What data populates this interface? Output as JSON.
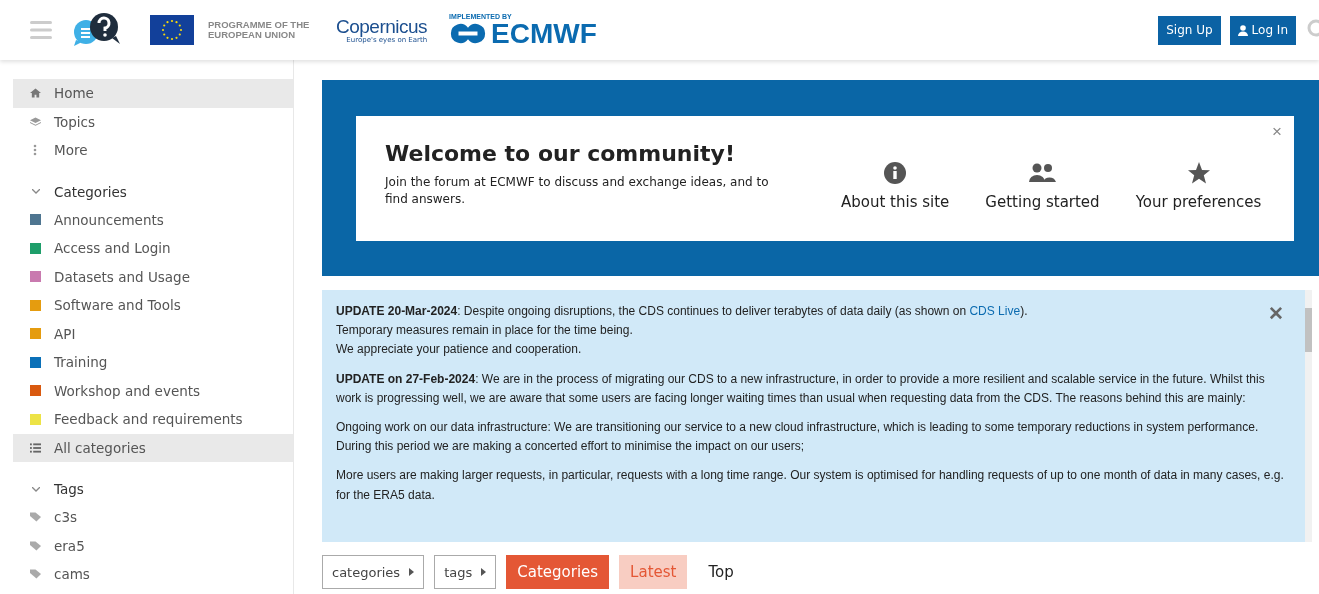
{
  "header": {
    "eu_label": "PROGRAMME OF THE EUROPEAN UNION",
    "copernicus": {
      "name": "Copernicus",
      "tagline": "Europe's eyes on Earth"
    },
    "ecmwf": {
      "caption": "IMPLEMENTED BY",
      "name": "ECMWF"
    },
    "buttons": [
      {
        "label": "Sign Up",
        "kind": "signup"
      },
      {
        "label": "Log In",
        "kind": "login"
      }
    ]
  },
  "sidebar": {
    "nav": [
      {
        "label": "Home",
        "kind": "home",
        "selected": true
      },
      {
        "label": "Topics",
        "kind": "topics",
        "selected": false
      },
      {
        "label": "More",
        "kind": "more",
        "selected": false
      }
    ],
    "categories_heading": "Categories",
    "categories_expanded": true,
    "tags_expanded": true,
    "categories": [
      {
        "label": "Announcements",
        "color": "#4e7590"
      },
      {
        "label": "Access and Login",
        "color": "#1e9e6a"
      },
      {
        "label": "Datasets and Usage",
        "color": "#c97aaf"
      },
      {
        "label": "Software and Tools",
        "color": "#e59c0f"
      },
      {
        "label": "API",
        "color": "#e59c0f"
      },
      {
        "label": "Training",
        "color": "#0a70b8"
      },
      {
        "label": "Workshop and events",
        "color": "#d9590f"
      },
      {
        "label": "Feedback and requirements",
        "color": "#ede346"
      }
    ],
    "all_categories": {
      "label": "All categories",
      "selected": true
    },
    "tags_heading": "Tags",
    "tags": [
      "c3s",
      "era5",
      "cams"
    ]
  },
  "welcome": {
    "title": "Welcome to our community!",
    "text": "Join the forum at ECMWF to discuss and exchange ideas, and to find answers.",
    "links": [
      {
        "label": "About this site",
        "kind": "info"
      },
      {
        "label": "Getting started",
        "kind": "users"
      },
      {
        "label": "Your preferences",
        "kind": "star"
      }
    ],
    "close": "×"
  },
  "notice": {
    "close": "✕",
    "first": {
      "before": "**UPDATE 20-Mar-2024**: Despite ongoing disruptions, the CDS continues to deliver terabytes of data daily (as shown on ",
      "link": "CDS Live",
      "after": ")."
    },
    "lines": [
      "Temporary measures remain in place for the time being.",
      "We appreciate your patience and cooperation."
    ],
    "paragraphs": [
      "**UPDATE on 27-Feb-2024**: We are in the process of migrating our CDS to a new infrastructure, in order to provide a more resilient and scalable service in the future. Whilst this work is progressing well, we are aware that some users are facing longer waiting times than usual when requesting data from the CDS. The reasons behind this are mainly:",
      "Ongoing work on our data infrastructure: We are transitioning our service to a new cloud infrastructure, which is leading to some temporary reductions in system performance. During this period we are making a concerted effort to minimise the impact on our users;",
      "More users are making larger requests, in particular, requests with a long time range. Our system is optimised for handling requests of up to one month of data in many cases, e.g. for the ERA5 data."
    ]
  },
  "navigation": {
    "dropdowns": [
      "categories",
      "tags"
    ],
    "tabs": [
      {
        "label": "Categories",
        "selected": true,
        "highlighted": false
      },
      {
        "label": "Latest",
        "selected": false,
        "highlighted": true
      },
      {
        "label": "Top",
        "selected": false,
        "highlighted": false
      }
    ]
  }
}
